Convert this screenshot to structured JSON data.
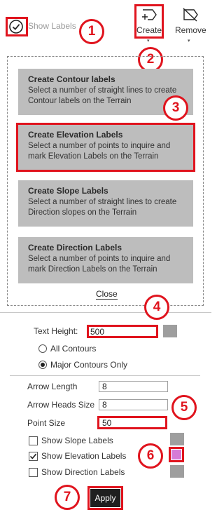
{
  "toolbar": {
    "show_labels": "Show Labels",
    "create_label": "Create",
    "remove_label": "Remove"
  },
  "menu": {
    "items": [
      {
        "title": "Create Contour labels",
        "desc": "Select a number of straight lines to create Contour labels on the Terrain"
      },
      {
        "title": "Create Elevation Labels",
        "desc": "Select a number of points to inquire and mark Elevation Labels on the Terrain"
      },
      {
        "title": "Create Slope Labels",
        "desc": "Select a number of straight lines to create Direction slopes on the Terrain"
      },
      {
        "title": "Create Direction Labels",
        "desc": "Select a number of points to inquire and mark Direction Labels on the Terrain"
      }
    ],
    "close_label": "Close"
  },
  "settings": {
    "text_height_label": "Text Height:",
    "text_height_value": "500",
    "all_contours": "All Contours",
    "major_contours": "Major Contours Only",
    "contour_mode": "major",
    "arrow_length_label": "Arrow Length",
    "arrow_length_value": "8",
    "arrow_heads_label": "Arrow Heads Size",
    "arrow_heads_value": "8",
    "point_size_label": "Point Size",
    "point_size_value": "50",
    "show_slope": {
      "label": "Show Slope Labels",
      "checked": false
    },
    "show_elevation": {
      "label": "Show Elevation Labels",
      "checked": true
    },
    "show_direction": {
      "label": "Show Direction Labels",
      "checked": false
    },
    "apply_label": "Apply"
  },
  "callouts": [
    "1",
    "2",
    "3",
    "4",
    "5",
    "6",
    "7"
  ],
  "colors": {
    "highlight": "#e0141e",
    "card_bg": "#bdbdbd",
    "swatch_gray": "#9e9e9e",
    "swatch_pink": "#d67bd6",
    "apply_bg": "#1f1f1f"
  }
}
